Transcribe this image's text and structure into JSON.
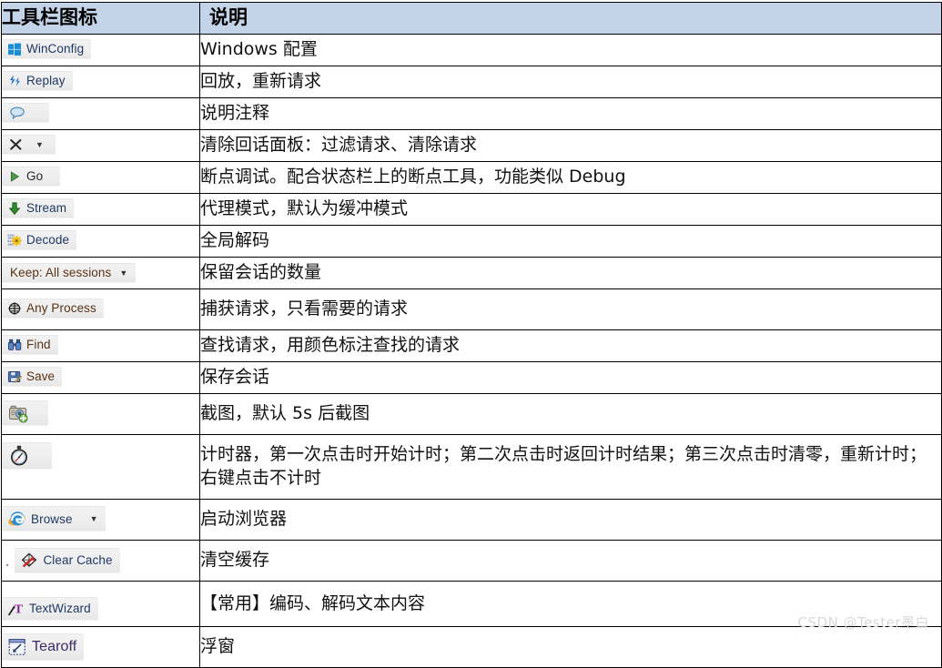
{
  "table": {
    "headers": {
      "icon_column": "工具栏图标",
      "desc_column": "说明"
    },
    "rows": [
      {
        "icon_name": "winconfig-icon",
        "icon_label": "WinConfig",
        "has_caret": false,
        "description": "Windows 配置"
      },
      {
        "icon_name": "replay-icon",
        "icon_label": "Replay",
        "has_caret": false,
        "description": "回放，重新请求"
      },
      {
        "icon_name": "comment-balloon-icon",
        "icon_label": "",
        "has_caret": false,
        "description": "说明注释"
      },
      {
        "icon_name": "remove-x-icon",
        "icon_label": "",
        "has_caret": true,
        "description": "清除回话面板：过滤请求、清除请求"
      },
      {
        "icon_name": "go-play-icon",
        "icon_label": "Go",
        "has_caret": false,
        "description": "断点调试。配合状态栏上的断点工具，功能类似 Debug"
      },
      {
        "icon_name": "stream-arrow-icon",
        "icon_label": "Stream",
        "has_caret": false,
        "description": "代理模式，默认为缓冲模式"
      },
      {
        "icon_name": "decode-gear-icon",
        "icon_label": "Decode",
        "has_caret": false,
        "description": "全局解码"
      },
      {
        "icon_name": "keep-sessions-dropdown",
        "icon_label": "Keep: All sessions",
        "has_caret": true,
        "description": "保留会话的数量"
      },
      {
        "icon_name": "any-process-target-icon",
        "icon_label": "Any Process",
        "has_caret": false,
        "description": "捕获请求，只看需要的请求"
      },
      {
        "icon_name": "find-binoculars-icon",
        "icon_label": "Find",
        "has_caret": false,
        "description": "查找请求，用颜色标注查找的请求"
      },
      {
        "icon_name": "save-disk-icon",
        "icon_label": "Save",
        "has_caret": false,
        "description": "保存会话"
      },
      {
        "icon_name": "camera-screenshot-icon",
        "icon_label": "",
        "has_caret": false,
        "description": "截图，默认 5s 后截图"
      },
      {
        "icon_name": "stopwatch-timer-icon",
        "icon_label": "",
        "has_caret": false,
        "description": "计时器，第一次点击时开始计时；第二次点击时返回计时结果；第三次点击时清零，重新计时；右键点击不计时"
      },
      {
        "icon_name": "browse-ie-icon",
        "icon_label": "Browse",
        "has_caret": true,
        "description": "启动浏览器"
      },
      {
        "icon_name": "clear-cache-icon",
        "icon_label": "Clear Cache",
        "has_caret": false,
        "description": "清空缓存"
      },
      {
        "icon_name": "textwizard-icon",
        "icon_label": "TextWizard",
        "has_caret": false,
        "description": "【常用】编码、解码文本内容"
      },
      {
        "icon_name": "tearoff-icon",
        "icon_label": "Tearoff",
        "has_caret": false,
        "description": "浮窗"
      }
    ]
  },
  "watermark": "CSDN @Tester墨白",
  "colors": {
    "header_background": "#c3d3e8",
    "border": "#000000",
    "button_background": "#eeeeee",
    "watermark_text": "#d9d9d9"
  }
}
